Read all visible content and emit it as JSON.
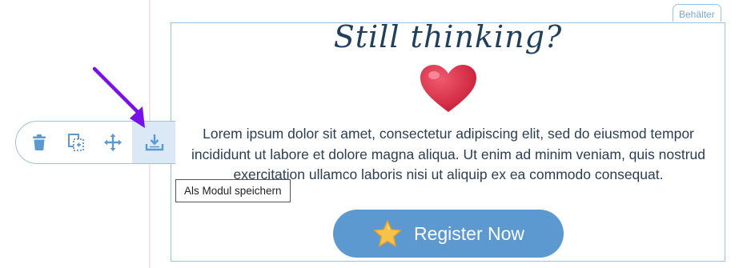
{
  "container": {
    "tag_label": "Behälter"
  },
  "content": {
    "headline": "Still thinking?",
    "body": "Lorem ipsum dolor sit amet, consectetur adipiscing elit, sed do eiusmod tempor incididunt ut labore et dolore magna aliqua. Ut enim ad minim veniam, quis nostrud exercitation ullamco laboris nisi ut aliquip ex ea commodo consequat.",
    "button": {
      "label": "Register Now",
      "icon": "star-icon"
    },
    "heart_icon": "heart-icon"
  },
  "toolbar": {
    "buttons": [
      {
        "name": "delete",
        "icon": "trash-icon"
      },
      {
        "name": "duplicate",
        "icon": "duplicate-icon"
      },
      {
        "name": "move",
        "icon": "move-icon"
      },
      {
        "name": "save-module",
        "icon": "download-icon",
        "active": true
      }
    ]
  },
  "tooltip": {
    "text": "Als Modul speichern"
  },
  "colors": {
    "accent": "#5b99d0",
    "border": "#9ec2e3",
    "headline": "#1f3f5c",
    "arrow": "#7a10e8",
    "heart": "#dc3545"
  }
}
